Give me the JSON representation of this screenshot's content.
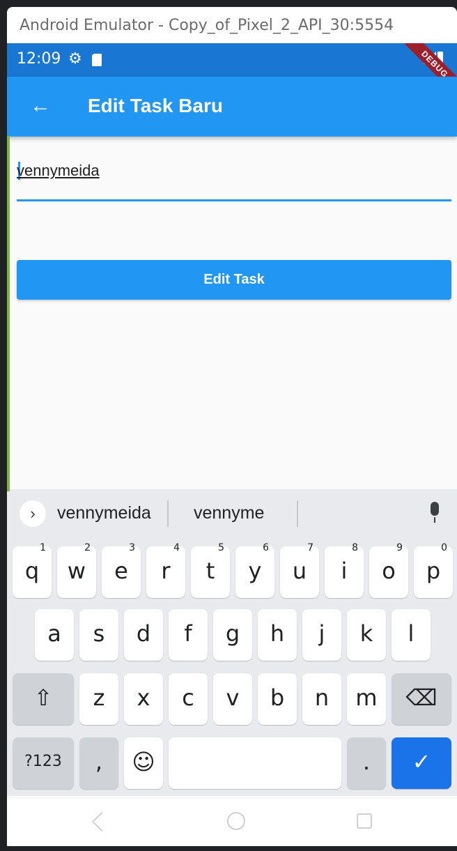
{
  "window": {
    "title": "Android Emulator - Copy_of_Pixel_2_API_30:5554"
  },
  "status_bar": {
    "time": "12:09",
    "debug_banner": "DEBUG"
  },
  "app_bar": {
    "title": "Edit Task Baru",
    "back_icon": "arrow-left-icon"
  },
  "form": {
    "task_value": "vennymeida",
    "submit_label": "Edit Task"
  },
  "keyboard": {
    "suggestions": [
      "vennymeida",
      "vennyme"
    ],
    "row1": [
      {
        "k": "q",
        "n": "1"
      },
      {
        "k": "w",
        "n": "2"
      },
      {
        "k": "e",
        "n": "3"
      },
      {
        "k": "r",
        "n": "4"
      },
      {
        "k": "t",
        "n": "5"
      },
      {
        "k": "y",
        "n": "6"
      },
      {
        "k": "u",
        "n": "7"
      },
      {
        "k": "i",
        "n": "8"
      },
      {
        "k": "o",
        "n": "9"
      },
      {
        "k": "p",
        "n": "0"
      }
    ],
    "row2": [
      "a",
      "s",
      "d",
      "f",
      "g",
      "h",
      "j",
      "k",
      "l"
    ],
    "row3": [
      "z",
      "x",
      "c",
      "v",
      "b",
      "n",
      "m"
    ],
    "symbols_label": "?123",
    "comma_label": ",",
    "period_label": ".",
    "colors": {
      "enter": "#1a73e8",
      "accent": "#2196f3"
    }
  }
}
